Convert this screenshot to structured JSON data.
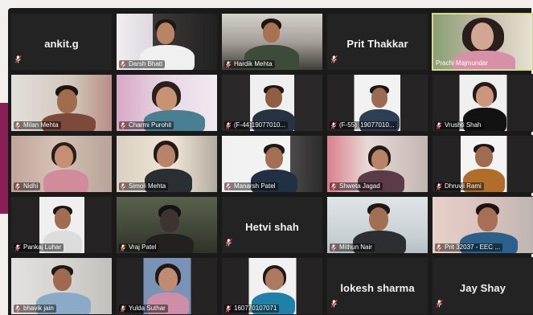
{
  "meeting": {
    "theme": {
      "accent": "#8a1f55",
      "active_speaker_border": "#d7d98b",
      "mic_muted": "#ff3b30"
    },
    "participants": [
      {
        "name": "ankit.g",
        "display": "name"
      },
      {
        "name": "Darsh Bhatt",
        "display": "video"
      },
      {
        "name": "Hardik Mehta",
        "display": "video"
      },
      {
        "name": "Prit Thakkar",
        "display": "name"
      },
      {
        "name": "Prachi Majmundar",
        "display": "video",
        "active_speaker": true
      },
      {
        "name": "Milan Mehta",
        "display": "video"
      },
      {
        "name": "Charmi Purohit",
        "display": "video"
      },
      {
        "name": "(F-44)19077010...",
        "display": "video"
      },
      {
        "name": "(F-55)_19077010...",
        "display": "video"
      },
      {
        "name": "Vrushti Shah",
        "display": "video"
      },
      {
        "name": "Nidhi",
        "display": "video"
      },
      {
        "name": "Simoli Mehta",
        "display": "video"
      },
      {
        "name": "Manarsh Patel",
        "display": "video"
      },
      {
        "name": "Shweta Jagad",
        "display": "video"
      },
      {
        "name": "Dhruvil Rami",
        "display": "video"
      },
      {
        "name": "Pankaj Luhar",
        "display": "video"
      },
      {
        "name": "Vraj Patel",
        "display": "video"
      },
      {
        "name": "Hetvi shah",
        "display": "name"
      },
      {
        "name": "Mithun Nair",
        "display": "video"
      },
      {
        "name": "Prit 32037 - EEC ...",
        "display": "video"
      },
      {
        "name": "bhavik jain",
        "display": "video"
      },
      {
        "name": "Yulda Suthar",
        "display": "video"
      },
      {
        "name": "160770107071",
        "display": "video"
      },
      {
        "name": "lokesh sharma",
        "display": "name"
      },
      {
        "name": "Jay Shay",
        "display": "name"
      }
    ]
  }
}
